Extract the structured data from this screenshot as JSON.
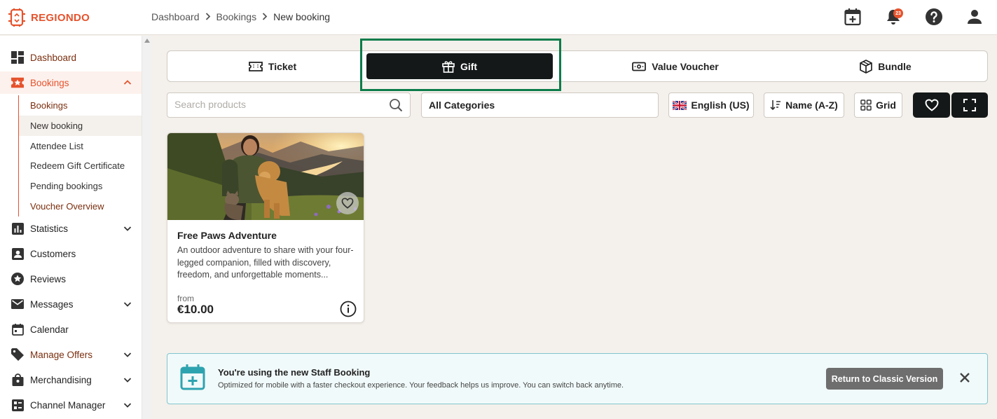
{
  "app": {
    "brand": "REGIONDO",
    "brand_color": "#e5532d"
  },
  "breadcrumb": [
    "Dashboard",
    "Bookings",
    "New booking"
  ],
  "header": {
    "notification_count": "23",
    "icons": [
      "calendar-plus-icon",
      "bell-icon",
      "help-icon",
      "user-icon"
    ]
  },
  "sidebar": {
    "dashboard": "Dashboard",
    "bookings": "Bookings",
    "bookings_sub": [
      "Bookings",
      "New booking",
      "Attendee List",
      "Redeem Gift Certificate",
      "Pending bookings",
      "Voucher Overview"
    ],
    "statistics": "Statistics",
    "customers": "Customers",
    "reviews": "Reviews",
    "messages": "Messages",
    "calendar": "Calendar",
    "manage_offers": "Manage Offers",
    "merchandising": "Merchandising",
    "channel_manager": "Channel Manager"
  },
  "product_types": {
    "ticket": "Ticket",
    "gift": "Gift",
    "value_voucher": "Value Voucher",
    "bundle": "Bundle",
    "selected": "Gift"
  },
  "filters": {
    "search_placeholder": "Search products",
    "category": "All Categories",
    "language": "English (US)",
    "sort": "Name (A-Z)",
    "view": "Grid"
  },
  "product": {
    "title": "Free Paws Adventure",
    "description": "An outdoor adventure to share with your four-legged companion, filled with discovery, freedom, and unforgettable moments...",
    "price_prefix": "from",
    "price": "€10.00"
  },
  "banner": {
    "title": "You're using the new Staff Booking",
    "text": "Optimized for mobile with a faster checkout experience. Your feedback helps us improve. You can switch back anytime.",
    "button": "Return to Classic Version"
  },
  "colors": {
    "accent": "#e5532d",
    "dark_button": "#141819",
    "highlight": "#0c7c4a",
    "banner_border": "#7fc6ce",
    "banner_icon": "#2ea3b0"
  }
}
